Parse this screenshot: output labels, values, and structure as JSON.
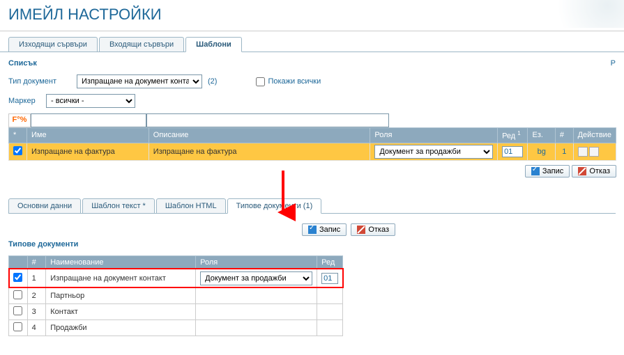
{
  "page_title": "ИМЕЙЛ НАСТРОЙКИ",
  "top_right_link": "Р",
  "tabs": [
    {
      "label": "Изходящи сървъри",
      "active": false
    },
    {
      "label": "Входящи сървъри",
      "active": false
    },
    {
      "label": "Шаблони",
      "active": true
    }
  ],
  "list_title": "Списък",
  "filters": {
    "doc_type_label": "Тип документ",
    "doc_type_value": "Изпращане на документ конта",
    "doc_type_count": "(2)",
    "show_all_label": "Покажи всички",
    "marker_label": "Маркер",
    "marker_value": "- всички -",
    "search_prefix": "F°%"
  },
  "grid": {
    "headers": {
      "star": "*",
      "name": "Име",
      "desc": "Описание",
      "role": "Роля",
      "ord": "Ред",
      "ord_sup": "1",
      "lang": "Ез.",
      "num": "#",
      "act": "Действие"
    },
    "row": {
      "name": "Изпращане на фактура",
      "desc": "Изпращане на фактура",
      "role": "Документ за продажби",
      "ord": "01",
      "lang": "bg",
      "num": "1"
    }
  },
  "buttons": {
    "save": "Запис",
    "cancel": "Отказ"
  },
  "sub_tabs": [
    {
      "label": "Основни данни",
      "active": false
    },
    {
      "label": "Шаблон текст *",
      "active": false
    },
    {
      "label": "Шаблон HTML",
      "active": false
    },
    {
      "label": "Типове документи (1)",
      "active": true
    }
  ],
  "sub_title": "Типове документи",
  "subgrid": {
    "headers": {
      "num": "#",
      "name": "Наименование",
      "role": "Роля",
      "ord": "Ред"
    },
    "rows": [
      {
        "checked": true,
        "num": "1",
        "name": "Изпращане на документ контакт",
        "role": "Документ за продажби",
        "ord": "01",
        "highlight": true
      },
      {
        "checked": false,
        "num": "2",
        "name": "Партньор",
        "role": "",
        "ord": "",
        "highlight": false
      },
      {
        "checked": false,
        "num": "3",
        "name": "Контакт",
        "role": "",
        "ord": "",
        "highlight": false
      },
      {
        "checked": false,
        "num": "4",
        "name": "Продажби",
        "role": "",
        "ord": "",
        "highlight": false
      }
    ]
  }
}
